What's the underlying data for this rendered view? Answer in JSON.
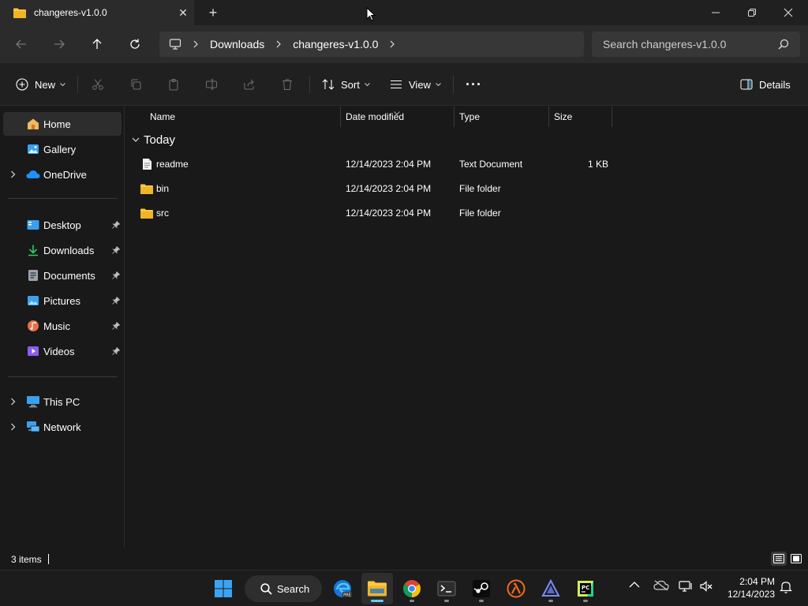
{
  "window": {
    "tab_title": "changeres-v1.0.0",
    "new_tab_glyph": "+",
    "close_tab_glyph": "✕"
  },
  "address": {
    "crumbs": [
      "Downloads",
      "changeres-v1.0.0"
    ],
    "search_placeholder": "Search changeres-v1.0.0"
  },
  "toolbar": {
    "new_label": "New",
    "sort_label": "Sort",
    "view_label": "View",
    "more_label": "···",
    "details_label": "Details"
  },
  "sidebar": {
    "items": [
      {
        "label": "Home",
        "icon": "home-icon"
      },
      {
        "label": "Gallery",
        "icon": "gallery-icon"
      },
      {
        "label": "OneDrive",
        "icon": "cloud-icon"
      },
      {
        "label": "Desktop",
        "icon": "desktop-icon"
      },
      {
        "label": "Downloads",
        "icon": "download-icon"
      },
      {
        "label": "Documents",
        "icon": "documents-icon"
      },
      {
        "label": "Pictures",
        "icon": "pictures-icon"
      },
      {
        "label": "Music",
        "icon": "music-icon"
      },
      {
        "label": "Videos",
        "icon": "videos-icon"
      },
      {
        "label": "This PC",
        "icon": "pc-icon"
      },
      {
        "label": "Network",
        "icon": "network-icon"
      }
    ]
  },
  "list": {
    "columns": [
      "Name",
      "Date modified",
      "Type",
      "Size"
    ],
    "group_label": "Today",
    "rows": [
      {
        "name": "readme",
        "date": "12/14/2023 2:04 PM",
        "type": "Text Document",
        "size": "1 KB",
        "icon": "text-file-icon"
      },
      {
        "name": "bin",
        "date": "12/14/2023 2:04 PM",
        "type": "File folder",
        "size": "",
        "icon": "folder-icon"
      },
      {
        "name": "src",
        "date": "12/14/2023 2:04 PM",
        "type": "File folder",
        "size": "",
        "icon": "folder-icon"
      }
    ]
  },
  "status": {
    "item_count": "3 items"
  },
  "taskbar": {
    "search_label": "Search",
    "time": "2:04 PM",
    "date": "12/14/2023"
  },
  "colors": {
    "accent": "#60cdff",
    "folder": "#ffc83d",
    "background": "#191919",
    "sidebar_active": "#2d2d2d"
  }
}
